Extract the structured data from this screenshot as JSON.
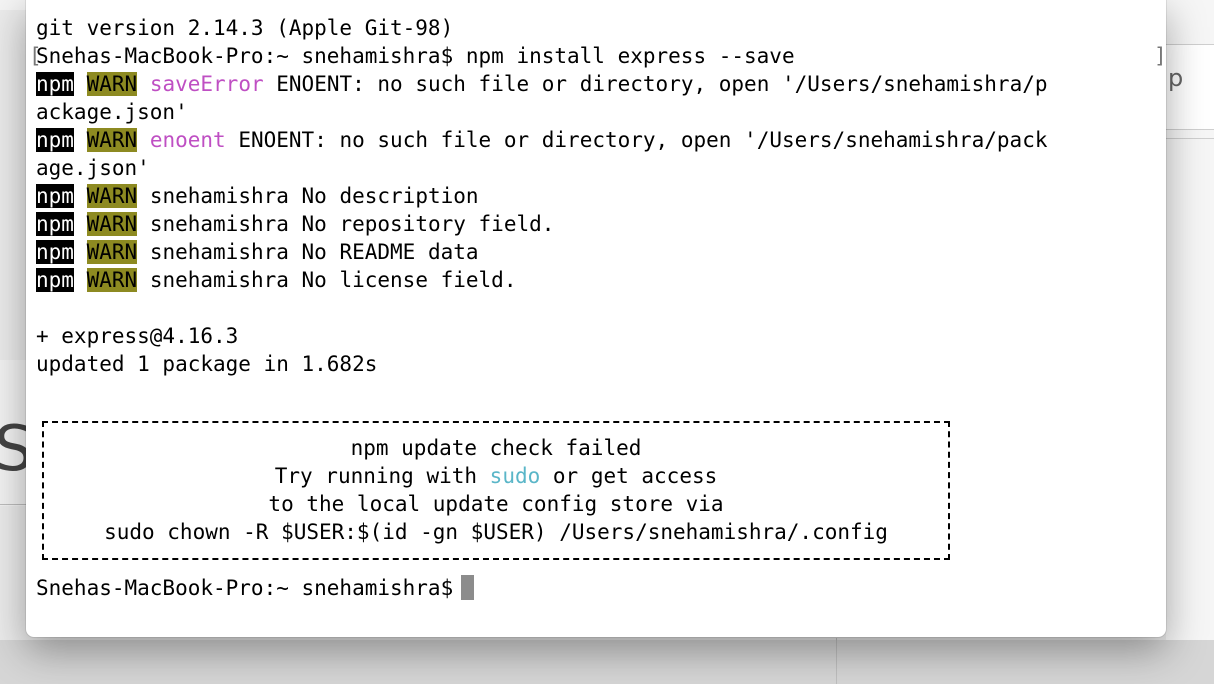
{
  "background": {
    "right_letter": "p",
    "left_letter": "S"
  },
  "terminal": {
    "line1": "git version 2.14.3 (Apple Git-98)",
    "line2_prompt": "Snehas-MacBook-Pro:~ snehamishra$ ",
    "line2_command": "npm install express --save",
    "warn1": {
      "npm": "npm",
      "warn": "WARN",
      "keyword": "saveError",
      "message": " ENOENT: no such file or directory, open '/Users/snehamishra/p"
    },
    "warn1_cont": "ackage.json'",
    "warn2": {
      "npm": "npm",
      "warn": "WARN",
      "keyword": "enoent",
      "message": " ENOENT: no such file or directory, open '/Users/snehamishra/pack"
    },
    "warn2_cont": "age.json'",
    "warn3": {
      "npm": "npm",
      "warn": "WARN",
      "message": " snehamishra No description"
    },
    "warn4": {
      "npm": "npm",
      "warn": "WARN",
      "message": " snehamishra No repository field."
    },
    "warn5": {
      "npm": "npm",
      "warn": "WARN",
      "message": " snehamishra No README data"
    },
    "warn6": {
      "npm": "npm",
      "warn": "WARN",
      "message": " snehamishra No license field."
    },
    "added": "+ express@4.16.3",
    "updated": "updated 1 package in 1.682s",
    "box": {
      "title": "npm update check failed",
      "line2_a": "Try running with ",
      "line2_sudo": "sudo",
      "line2_b": " or get access",
      "line3": "to the local update config store via",
      "line4": "sudo chown -R $USER:$(id -gn $USER) /Users/snehamishra/.config"
    },
    "final_prompt": "Snehas-MacBook-Pro:~ snehamishra$"
  },
  "colors": {
    "warn_bg": "#8d8a21",
    "npm_bg": "#000000",
    "magenta": "#bf4fc3",
    "yellow": "#a9a536",
    "cyan": "#5ab6c8"
  }
}
